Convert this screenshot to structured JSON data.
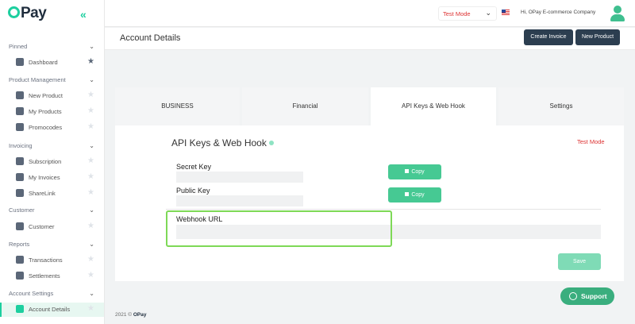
{
  "brand": {
    "name": "Pay",
    "footer_brand": "OPay"
  },
  "sidebar": {
    "sections": [
      {
        "label": "Pinned",
        "items": [
          {
            "label": "Dashboard",
            "icon": "dashboard-icon",
            "pinned": true
          }
        ]
      },
      {
        "label": "Product Management",
        "items": [
          {
            "label": "New Product",
            "icon": "new-product-icon"
          },
          {
            "label": "My Products",
            "icon": "products-icon"
          },
          {
            "label": "Promocodes",
            "icon": "promocode-icon"
          }
        ]
      },
      {
        "label": "Invoicing",
        "items": [
          {
            "label": "Subscription",
            "icon": "subscription-icon"
          },
          {
            "label": "My Invoices",
            "icon": "invoices-icon"
          },
          {
            "label": "ShareLink",
            "icon": "sharelink-icon"
          }
        ]
      },
      {
        "label": "Customer",
        "items": [
          {
            "label": "Customer",
            "icon": "customer-icon"
          }
        ]
      },
      {
        "label": "Reports",
        "items": [
          {
            "label": "Transactions",
            "icon": "transactions-icon"
          },
          {
            "label": "Settlements",
            "icon": "settlements-icon"
          }
        ]
      },
      {
        "label": "Account Settings",
        "items": [
          {
            "label": "Account Details",
            "icon": "account-details-icon",
            "active": true
          }
        ]
      }
    ]
  },
  "topbar": {
    "mode": "Test Mode",
    "greeting": "Hi, OPay E-commerce Company",
    "flag_icon": "us-flag-icon"
  },
  "page": {
    "title": "Account Details",
    "create_invoice": "Create Invoice",
    "new_product": "New Product"
  },
  "tabs": [
    "BUSINESS",
    "Financial",
    "API Keys & Web Hook",
    "Settings"
  ],
  "active_tab": "API Keys & Web Hook",
  "api": {
    "title": "API Keys & Web Hook",
    "mode": "Test Mode",
    "secret_key_label": "Secret Key",
    "secret_key_value": "",
    "public_key_label": "Public Key",
    "public_key_value": "",
    "copy_label": "Copy",
    "webhook_label": "Webhook URL",
    "webhook_value": "",
    "save_label": "Save"
  },
  "footer": {
    "year": "2021 ©"
  },
  "support": {
    "label": "Support"
  },
  "colors": {
    "accent": "#1dcf9f",
    "dark_button": "#2c3e50",
    "copy_button": "#46c993",
    "highlight": "#7ed957",
    "test_mode": "#dd3333"
  }
}
